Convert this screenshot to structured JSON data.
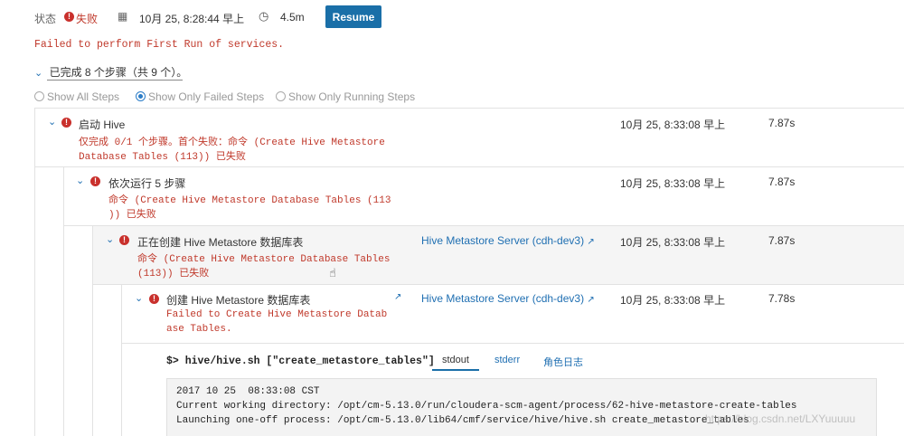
{
  "header": {
    "status_label": "状态",
    "status_value": "失败",
    "date_time": "10月 25, 8:28:44 早上",
    "duration": "4.5m",
    "resume_label": "Resume"
  },
  "error_message": "Failed to perform First Run of services.",
  "summary": "已完成 8 个步骤（共 9 个）。",
  "filters": [
    {
      "label": "Show All Steps",
      "selected": false
    },
    {
      "label": "Show Only Failed Steps",
      "selected": true
    },
    {
      "label": "Show Only Running Steps",
      "selected": false
    }
  ],
  "steps": [
    {
      "title": "启动 Hive",
      "msg1": "仅完成 0/1 个步骤。首个失败：命令 (Create Hive Metastore",
      "msg2": "Database Tables (113)) 已失败",
      "role": "",
      "time": "10月 25, 8:33:08 早上",
      "duration": "7.87s"
    },
    {
      "title": "依次运行 5 步骤",
      "msg1": "命令 (Create Hive Metastore Database Tables (113",
      "msg2": ")) 已失败",
      "role": "",
      "time": "10月 25, 8:33:08 早上",
      "duration": "7.87s"
    },
    {
      "title": "正在创建 Hive Metastore 数据库表",
      "msg1": "命令 (Create Hive Metastore Database Tables",
      "msg2": "(113)) 已失败",
      "role": "Hive Metastore Server (cdh-dev3)",
      "time": "10月 25, 8:33:08 早上",
      "duration": "7.87s"
    },
    {
      "title": "创建 Hive Metastore 数据库表",
      "msg1": "Failed to Create Hive Metastore Datab",
      "msg2": "ase Tables.",
      "role": "Hive Metastore Server (cdh-dev3)",
      "time": "10月 25, 8:33:08 早上",
      "duration": "7.78s"
    }
  ],
  "command": {
    "prompt": "$>",
    "text": "hive/hive.sh [\"create_metastore_tables\"]"
  },
  "tabs": [
    "stdout",
    "stderr",
    "角色日志"
  ],
  "log_lines": [
    "2017 10 25  08:33:08 CST",
    "Current working directory: /opt/cm-5.13.0/run/cloudera-scm-agent/process/62-hive-metastore-create-tables",
    "Launching one-off process: /opt/cm-5.13.0/lib64/cmf/service/hive/hive.sh create_metastore_tables"
  ],
  "watermark": "https://blog.csdn.net/LXYuuuuu",
  "colors": {
    "accent": "#1a6fa8",
    "error": "#c9302c",
    "link": "#1f6fb2"
  }
}
